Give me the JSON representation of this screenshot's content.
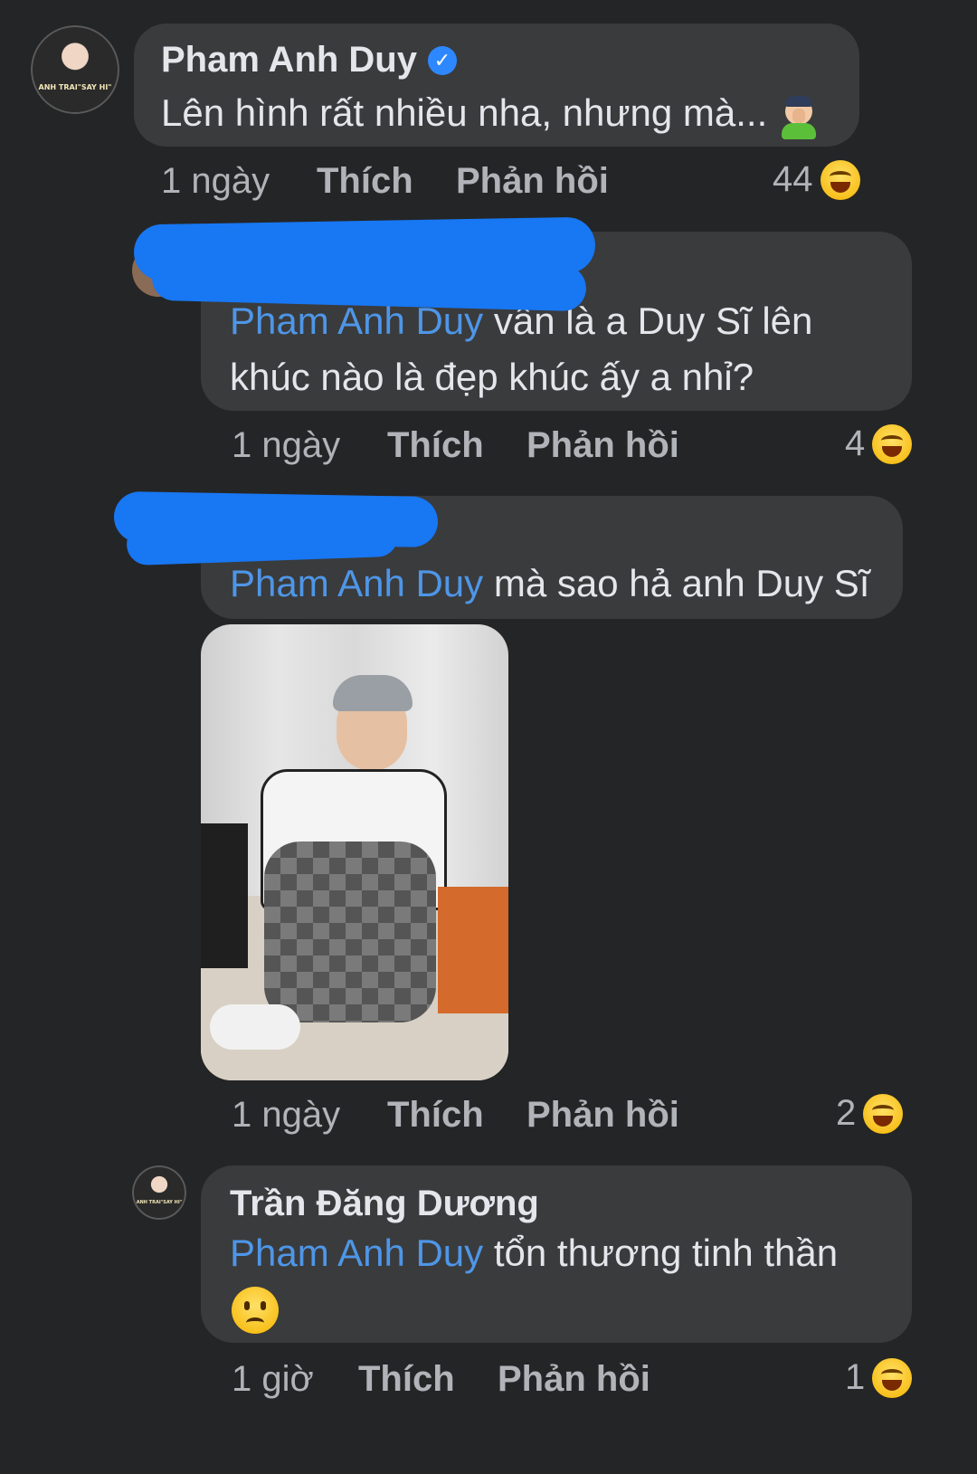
{
  "comments": [
    {
      "author": "Pham Anh Duy",
      "verified": true,
      "text": "Lên hình rất nhiều nha, nhưng mà...",
      "emoji": "facepalm-emoji",
      "avatar_caption": "ANH TRAI\"SAY HI\"",
      "time": "1 ngày",
      "like_label": "Thích",
      "reply_label": "Phản hồi",
      "reaction_count": "44",
      "reaction_icon": "laugh-icon"
    },
    {
      "author": "",
      "mention": "Pham Anh Duy",
      "text": "vẫn là a Duy Sĩ lên khúc nào là đẹp khúc ấy a nhỉ?",
      "time": "1 ngày",
      "like_label": "Thích",
      "reply_label": "Phản hồi",
      "reaction_count": "4",
      "reaction_icon": "laugh-icon"
    },
    {
      "author": "",
      "mention": "Pham Anh Duy",
      "text": "mà sao hả anh Duy Sĩ",
      "has_photo": true,
      "time": "1 ngày",
      "like_label": "Thích",
      "reply_label": "Phản hồi",
      "reaction_count": "2",
      "reaction_icon": "laugh-icon"
    },
    {
      "author": "Trần Đăng Dương",
      "mention": "Pham Anh Duy",
      "text": "tổn thương tinh thần",
      "emoji": "sad-face-emoji",
      "avatar_caption": "ANH TRAI\"SAY HI\"",
      "time": "1 giờ",
      "like_label": "Thích",
      "reply_label": "Phản hồi",
      "reaction_count": "1",
      "reaction_icon": "laugh-icon"
    }
  ],
  "colors": {
    "background": "#242526",
    "bubble": "#3a3b3c",
    "mention": "#4e96e8",
    "redaction_scribble": "#1877f2"
  }
}
